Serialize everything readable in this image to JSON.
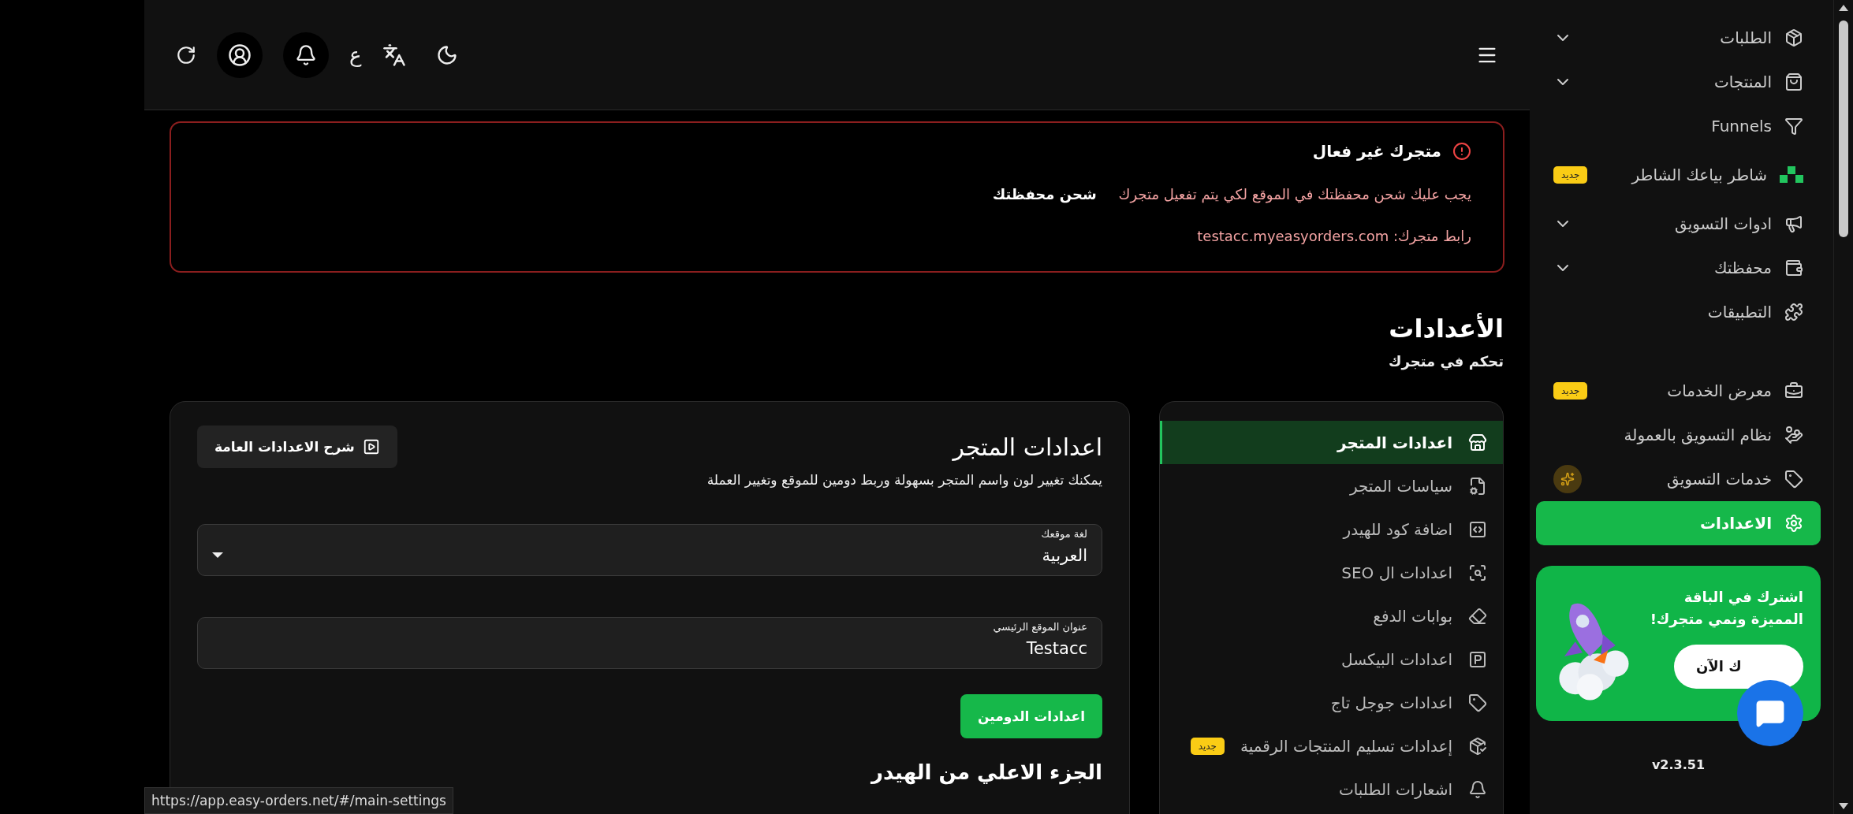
{
  "header": {
    "language_key": "ع"
  },
  "alert": {
    "title": "متجرك غير فعال",
    "message": "يجب عليك شحن محفظتك في الموقع لكي يتم تفعيل متجرك",
    "action": "شحن محفظتك",
    "store_link": "رابط متجرك: testacc.myeasyorders.com"
  },
  "page": {
    "title": "الأعدادات",
    "subtitle": "تحكم في متجرك"
  },
  "settings_nav": {
    "items": [
      {
        "label": "اعدادات المتجر",
        "selected": true
      },
      {
        "label": "سياسات المتجر",
        "selected": false
      },
      {
        "label": "اضافة كود للهيدر",
        "selected": false
      },
      {
        "label": "اعدادات ال SEO",
        "selected": false
      },
      {
        "label": "بوابات الدفع",
        "selected": false
      },
      {
        "label": "اعدادات البيكسل",
        "selected": false
      },
      {
        "label": "اعدادات جوجل تاج",
        "selected": false
      },
      {
        "label": "إعدادات تسليم المنتجات الرقمية",
        "selected": false,
        "badge": "جديد"
      },
      {
        "label": "اشعارات الطلبات",
        "selected": false
      }
    ]
  },
  "store_settings": {
    "title": "اعدادات المتجر",
    "description": "يمكنك تغيير لون واسم المتجر بسهولة وربط دومين للموقع وتغيير العملة",
    "help_button": "شرح الاعدادات العامة",
    "fields": [
      {
        "kind": "select",
        "label": "لغة موقعك",
        "value": "العربية"
      },
      {
        "kind": "text",
        "label": "عنوان الموقع الرئيسي",
        "value": "Testacc"
      }
    ],
    "domain_button": "اعدادات الدومين",
    "section_heading": "الجزء الاعلي من الهيدر"
  },
  "sidebar": {
    "items": [
      {
        "label": "الطلبات",
        "selected": false,
        "expandable": true
      },
      {
        "label": "المنتجات",
        "selected": false,
        "expandable": true
      },
      {
        "label": "Funnels",
        "selected": false,
        "expandable": false
      },
      {
        "label": "شاطر بياعك الشاطر",
        "selected": false,
        "expandable": false,
        "badge": "جديد"
      },
      {
        "label": "ادوات التسويق",
        "selected": false,
        "expandable": true
      },
      {
        "label": "محفظتك",
        "selected": false,
        "expandable": true
      },
      {
        "label": "التطبيقات",
        "selected": false,
        "expandable": false
      },
      {
        "label": "معرض الخدمات",
        "selected": false,
        "expandable": false,
        "badge": "جديد"
      },
      {
        "label": "نظام التسويق بالعمولة",
        "selected": false,
        "expandable": false
      },
      {
        "label": "خدمات التسويق",
        "selected": false,
        "expandable": false,
        "sparkle_badge": true
      },
      {
        "label": "الاعدادات",
        "selected": true,
        "expandable": false
      }
    ]
  },
  "promo": {
    "text": "اشترك في الباقة المميزة ونمي متجرك!",
    "button": "ك الآن"
  },
  "version": "v2.3.51",
  "status_url": "https://app.easy-orders.net/#/main-settings"
}
